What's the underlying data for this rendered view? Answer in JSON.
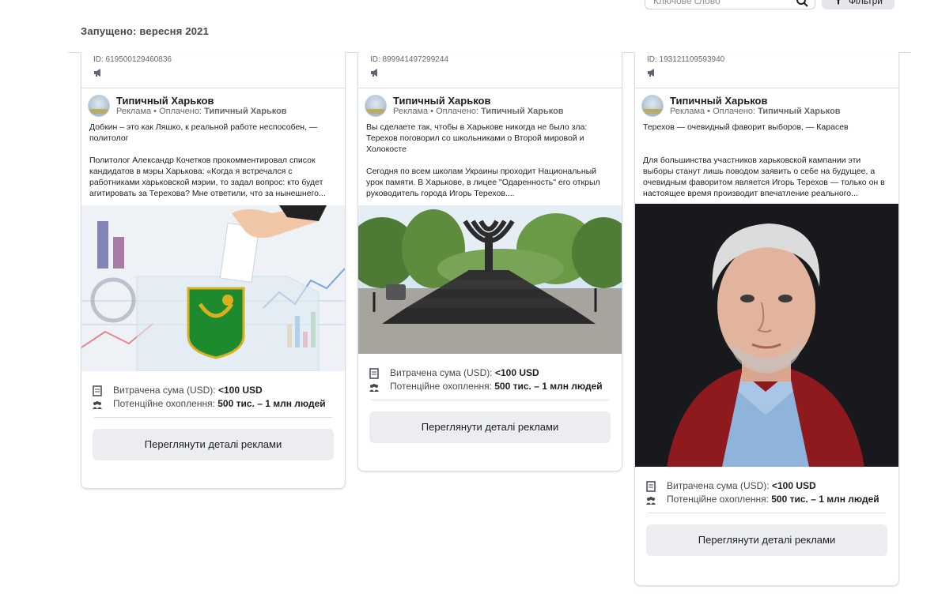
{
  "toolbar": {
    "search_placeholder": "Ключове слово",
    "filter_label": "Фільтри"
  },
  "launched_label": "Запущено: вересня 2021",
  "cards": [
    {
      "id": "ID: 619500129460836",
      "page_name": "Типичный Харьков",
      "sub_prefix": "Реклама • Оплачено: ",
      "sub_payer": "Типичный Харьков",
      "body": [
        "Добкин – это как Ляшко, к реальной работе неспособен, — политолог",
        "",
        "Политолог Александр Кочетков прокомментировал список кандидатов в мэры Харькова: «Когда я встречался с работниками харьковской мэрии, то задал вопрос: кто будет агитировать за Терехова? Мне ответили, что за нынешнего..."
      ],
      "image_icon": "ballot-box-coat-of-arms-image",
      "spend_label": "Витрачена сума (USD): ",
      "spend_value": "<100 USD",
      "reach_label": "Потенційне охоплення: ",
      "reach_value": "500 тис. – 1 млн людей",
      "button": "Переглянути деталі реклами"
    },
    {
      "id": "ID: 899941497299244",
      "page_name": "Типичный Харьков",
      "sub_prefix": "Реклама • Оплачено: ",
      "sub_payer": "Типичный Харьков",
      "body": [
        "Вы сделаете так, чтобы в Харькове никогда не было зла: Терехов поговорил со школьниками о Второй мировой и Холокосте",
        "",
        "Сегодня по всем школам Украины проходит Национальный урок памяти. В Харькове, в лицее \"Одаренность\" его открыл руководитель города Игорь Терехов...."
      ],
      "image_icon": "menorah-monument-image",
      "spend_label": "Витрачена сума (USD): ",
      "spend_value": "<100 USD",
      "reach_label": "Потенційне охоплення: ",
      "reach_value": "500 тис. – 1 млн людей",
      "button": "Переглянути деталі реклами"
    },
    {
      "id": "ID: 193121109593940",
      "page_name": "Типичный Харьков",
      "sub_prefix": "Реклама • Оплачено: ",
      "sub_payer": "Типичный Харьков",
      "body": [
        "Терехов — очевидный фаворит выборов, — Карасев",
        "",
        "Для большинства участников харьковской кампании эти выборы станут лишь поводом заявить о себе на будущее, а очевидным фаворитом является Игорь Терехов — только он в настоящее время производит впечатление реального..."
      ],
      "image_icon": "portrait-photo-image",
      "spend_label": "Витрачена сума (USD): ",
      "spend_value": "<100 USD",
      "reach_label": "Потенційне охоплення: ",
      "reach_value": "500 тис. – 1 млн людей",
      "button": "Переглянути деталі реклами"
    }
  ]
}
